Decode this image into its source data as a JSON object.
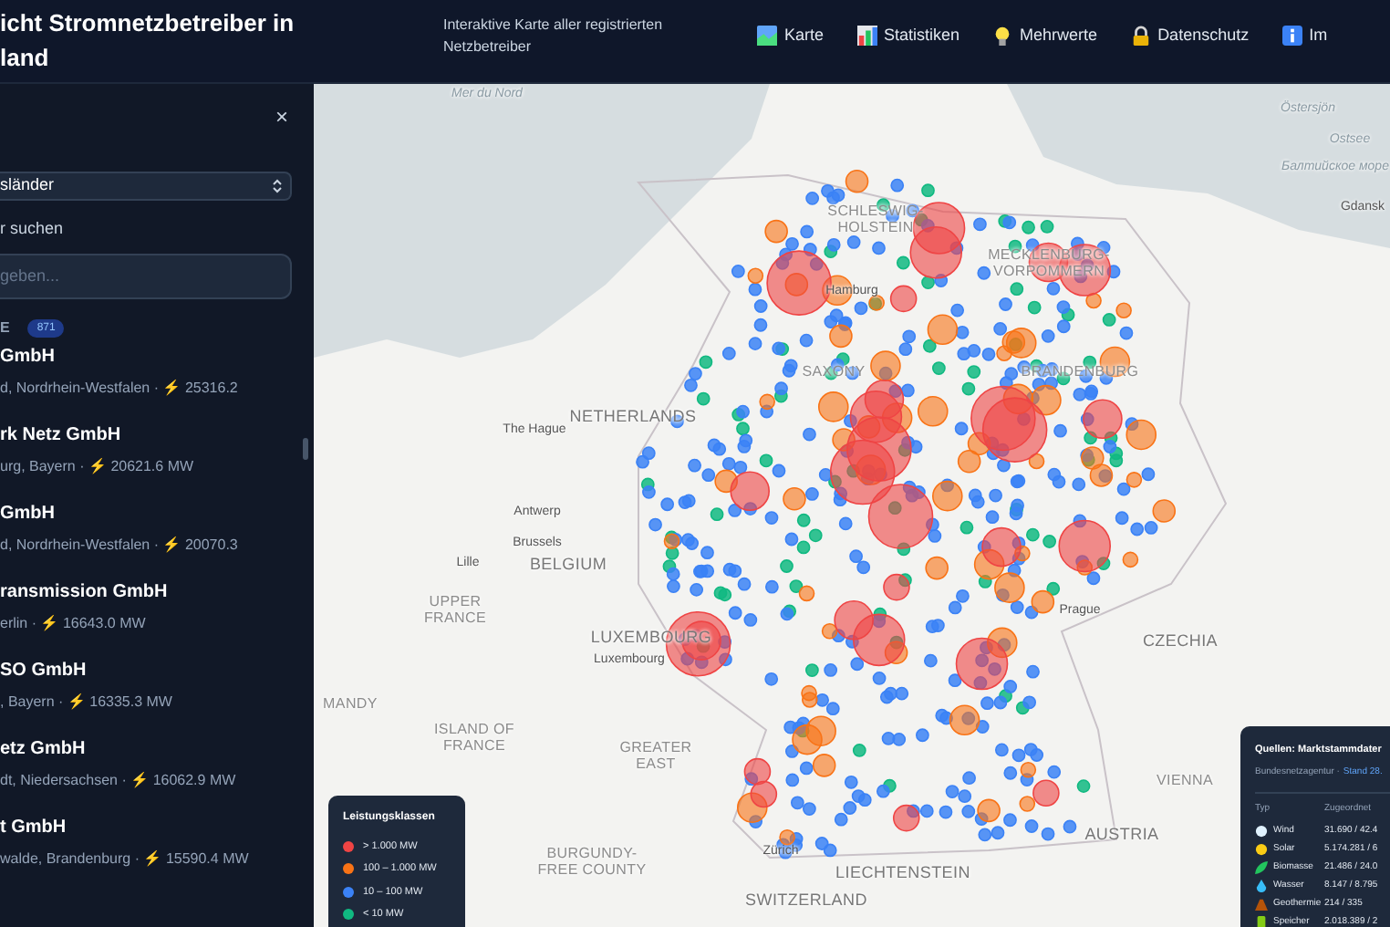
{
  "header": {
    "title": "icht Stromnetzbetreiber in land",
    "subtitle": "Interaktive Karte aller registrierten Netzbetreiber",
    "nav": [
      "Karte",
      "Statistiken",
      "Mehrwerte",
      "Datenschutz",
      "Im"
    ]
  },
  "sidebar": {
    "close": "×",
    "select": {
      "value": "sländer"
    },
    "search": {
      "label": "r suchen",
      "placeholder": "geben..."
    },
    "section": {
      "label": "E",
      "count": "871"
    },
    "items": [
      {
        "name": "GmbH",
        "details": "d, Nordrhein-Westfalen · ⚡ 25316.2"
      },
      {
        "name": "rk Netz GmbH",
        "details": "urg, Bayern · ⚡ 20621.6 MW"
      },
      {
        "name": "GmbH",
        "details": "d, Nordrhein-Westfalen · ⚡ 20070.3"
      },
      {
        "name": "ransmission GmbH",
        "details": "erlin · ⚡ 16643.0 MW"
      },
      {
        "name": "SO GmbH",
        "details": ", Bayern · ⚡ 16335.3 MW"
      },
      {
        "name": "etz GmbH",
        "details": "dt, Niedersachsen · ⚡ 16062.9 MW"
      },
      {
        "name": "t GmbH",
        "details": "walde, Brandenburg · ⚡ 15590.4 MW"
      }
    ]
  },
  "map": {
    "labels": [
      {
        "text": "Mer du Nord",
        "kind": "sea"
      },
      {
        "text": "Östersjön",
        "kind": "sea"
      },
      {
        "text": "Ostsee",
        "kind": "sea"
      },
      {
        "text": "Балтийское море",
        "kind": "sea"
      },
      {
        "text": "Gdansk",
        "kind": "city"
      },
      {
        "text": "SCHLESWIG-HOLSTEIN",
        "kind": "region"
      },
      {
        "text": "MECKLENBURG-VORPOMMERN",
        "kind": "region"
      },
      {
        "text": "Hamburg",
        "kind": "city"
      },
      {
        "text": "SAXONY",
        "kind": "region"
      },
      {
        "text": "BRANDENBURG",
        "kind": "region"
      },
      {
        "text": "NETHERLANDS",
        "kind": "country"
      },
      {
        "text": "The Hague",
        "kind": "city"
      },
      {
        "text": "Antwerp",
        "kind": "city"
      },
      {
        "text": "Brussels",
        "kind": "city"
      },
      {
        "text": "BELGIUM",
        "kind": "country"
      },
      {
        "text": "Lille",
        "kind": "city"
      },
      {
        "text": "UPPER FRANCE",
        "kind": "region"
      },
      {
        "text": "LUXEMBOURG",
        "kind": "country"
      },
      {
        "text": "Luxembourg",
        "kind": "city"
      },
      {
        "text": "Prague",
        "kind": "city"
      },
      {
        "text": "CZECHIA",
        "kind": "country"
      },
      {
        "text": "MANDY",
        "kind": "region"
      },
      {
        "text": "ISLAND OF FRANCE",
        "kind": "region"
      },
      {
        "text": "GREATER EAST",
        "kind": "region"
      },
      {
        "text": "VIENNA",
        "kind": "region"
      },
      {
        "text": "AUSTRIA",
        "kind": "country"
      },
      {
        "text": "BURGUNDY-FREE COUNTY",
        "kind": "region"
      },
      {
        "text": "Zürich",
        "kind": "city"
      },
      {
        "text": "LIECHTENSTEIN",
        "kind": "country"
      },
      {
        "text": "SWITZERLAND",
        "kind": "country"
      }
    ]
  },
  "legend": {
    "title": "Leistungsklassen",
    "items": [
      {
        "label": "> 1.000 MW",
        "color": "#ef4444"
      },
      {
        "label": "100 – 1.000 MW",
        "color": "#f97316"
      },
      {
        "label": "10 – 100 MW",
        "color": "#3b82f6"
      },
      {
        "label": "< 10 MW",
        "color": "#10b981"
      }
    ]
  },
  "sources": {
    "title": "Quellen: Marktstammdater",
    "agency": "Bundesnetzagentur ·",
    "link": "Stand 28.",
    "columns": [
      "Typ",
      "Zugeordnet"
    ],
    "rows": [
      {
        "type": "Wind",
        "value": "31.690 / 42.4"
      },
      {
        "type": "Solar",
        "value": "5.174.281 / 6"
      },
      {
        "type": "Biomasse",
        "value": "21.486 / 24.0"
      },
      {
        "type": "Wasser",
        "value": "8.147 / 8.795"
      },
      {
        "type": "Geothermie",
        "value": "214 / 335"
      },
      {
        "type": "Speicher",
        "value": "2.018.389 / 2"
      }
    ]
  }
}
